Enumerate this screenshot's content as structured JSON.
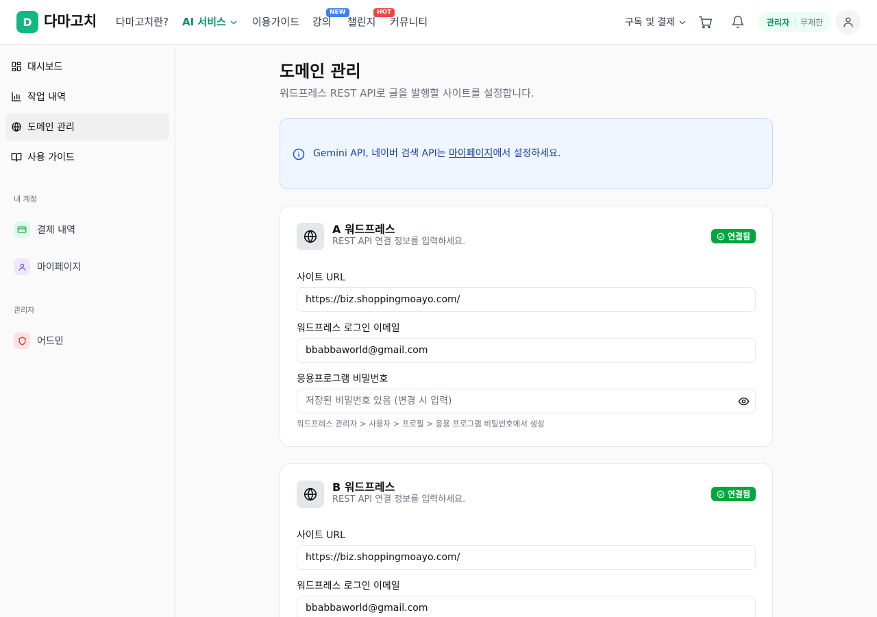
{
  "brand": {
    "badge": "D",
    "name": "다마고치"
  },
  "nav": {
    "about": "다마고치란?",
    "ai_service": "AI 서비스",
    "guide": "이용가이드",
    "lecture": "강의",
    "lecture_tag": "NEW",
    "challenge": "챌린지",
    "challenge_tag": "HOT",
    "community": "커뮤니티",
    "subscription": "구독 및 결제"
  },
  "plan": {
    "role": "관리자",
    "limit": "무제한"
  },
  "sidebar": {
    "items": [
      {
        "label": "대시보드"
      },
      {
        "label": "작업 내역"
      },
      {
        "label": "도메인 관리"
      },
      {
        "label": "사용 가이드"
      }
    ],
    "account_section": "내 계정",
    "payments": "결제 내역",
    "mypage": "마이페이지",
    "admin_section": "관리자",
    "admin": "어드민"
  },
  "page": {
    "title": "도메인 관리",
    "subtitle": "워드프레스 REST API로 글을 발행할 사이트를 설정합니다."
  },
  "info": {
    "prefix": "Gemini API, 네이버 검색 API는 ",
    "link": "마이페이지",
    "suffix": "에서 설정하세요."
  },
  "sites": [
    {
      "title": "A 워드프레스",
      "desc": "REST API 연결 정보를 입력하세요.",
      "status": "연결됨",
      "url_label": "사이트 URL",
      "url_value": "https://biz.shoppingmoayo.com/",
      "email_label": "워드프레스 로그인 이메일",
      "email_value": "bbabbaworld@gmail.com",
      "pw_label": "응용프로그램 비밀번호",
      "pw_placeholder": "저장된 비밀번호 있음 (변경 시 입력)",
      "pw_hint": "워드프레스 관리자 > 사용자 > 프로필 > 응용 프로그램 비밀번호에서 생성"
    },
    {
      "title": "B 워드프레스",
      "desc": "REST API 연결 정보를 입력하세요.",
      "status": "연결됨",
      "url_label": "사이트 URL",
      "url_value": "https://biz.shoppingmoayo.com/",
      "email_label": "워드프레스 로그인 이메일",
      "email_value": "bbabbaworld@gmail.com"
    }
  ],
  "colors": {
    "accent": "#059669",
    "brand": "#10b981",
    "connected": "#00a63e",
    "info_bg": "#eff6ff"
  }
}
